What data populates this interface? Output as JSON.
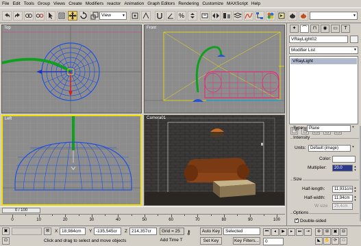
{
  "menu": [
    "File",
    "Edit",
    "Tools",
    "Group",
    "Views",
    "Create",
    "Modifiers",
    "reactor",
    "Animation",
    "Graph Editors",
    "Rendering",
    "Customize",
    "MAXScript",
    "Help"
  ],
  "toolbar": {
    "view_dropdown": "View",
    "selection_set": ""
  },
  "viewports": {
    "top": "Top",
    "front": "Front",
    "left": "Left",
    "camera": "Camera01"
  },
  "command_panel": {
    "tabs": [
      "create-icon",
      "modify-icon",
      "hierarchy-icon",
      "motion-icon",
      "display-icon",
      "utilities-icon"
    ],
    "object_name": "VRayLight02",
    "modifier_list": "Modifier List",
    "stack_item": "VRayLight",
    "type_label": "Type:",
    "type_value": "Plane",
    "intensity_title": "Intensity",
    "units_label": "Units:",
    "units_value": "Default (image)",
    "color_label": "Color:",
    "multiplier_label": "Multiplier:",
    "multiplier_value": "20.0",
    "size_title": "Size",
    "half_length_label": "Half-length:",
    "half_length_value": "11,931cm",
    "half_width_label": "Half-width:",
    "half_width_value": "11,94cm",
    "w_size_label": "W size",
    "w_size_value": "25,4cm",
    "options_title": "Options",
    "double_sided_label": "Double-sided"
  },
  "timeline": {
    "frame_display": "0 / 100",
    "ticks": [
      "0",
      "10",
      "20",
      "30",
      "40",
      "50",
      "60",
      "70",
      "80",
      "90",
      "100"
    ]
  },
  "status": {
    "x_label": "X",
    "x_value": "18,984cm",
    "y_label": "Y",
    "y_value": "-135,545cr",
    "z_label": "Z",
    "z_value": "214,357cr",
    "grid": "Grid = 25",
    "auto_key": "Auto Key",
    "selected": "Selected",
    "set_key": "Set Key",
    "key_filters": "Key Filters...",
    "add_time_tag": "Add Time T",
    "prompt": "Click and drag to select and move objects",
    "frame_value": "0"
  },
  "colors": {
    "ui_bg": "#d4d0c8",
    "viewport_bg": "#8c8c8c",
    "active_viewport_border": "#f0e000",
    "sofa_pink": "#e0307a",
    "lamp_blue": "#2050e0",
    "lamp_green": "#10a020"
  }
}
